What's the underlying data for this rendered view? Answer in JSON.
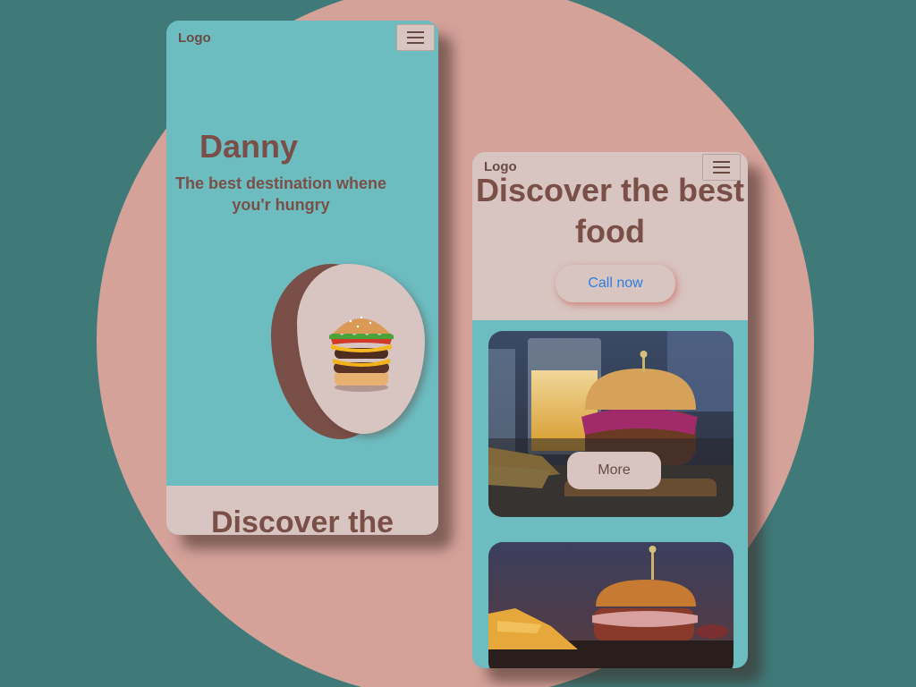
{
  "left_phone": {
    "logo": "Logo",
    "hero_name": "Danny",
    "hero_tagline": "The best destination whene you'r hungry",
    "section_title": "Discover the"
  },
  "right_phone": {
    "logo": "Logo",
    "title": "Discover the best food",
    "call_button": "Call now",
    "card_button": "More"
  },
  "colors": {
    "background": "#3f7a79",
    "circle": "#d5a29a",
    "teal_panel": "#6cbcc0",
    "rose_panel": "#d8c4c0",
    "brown_text": "#7a4f48",
    "link_blue": "#2d7ee0"
  }
}
